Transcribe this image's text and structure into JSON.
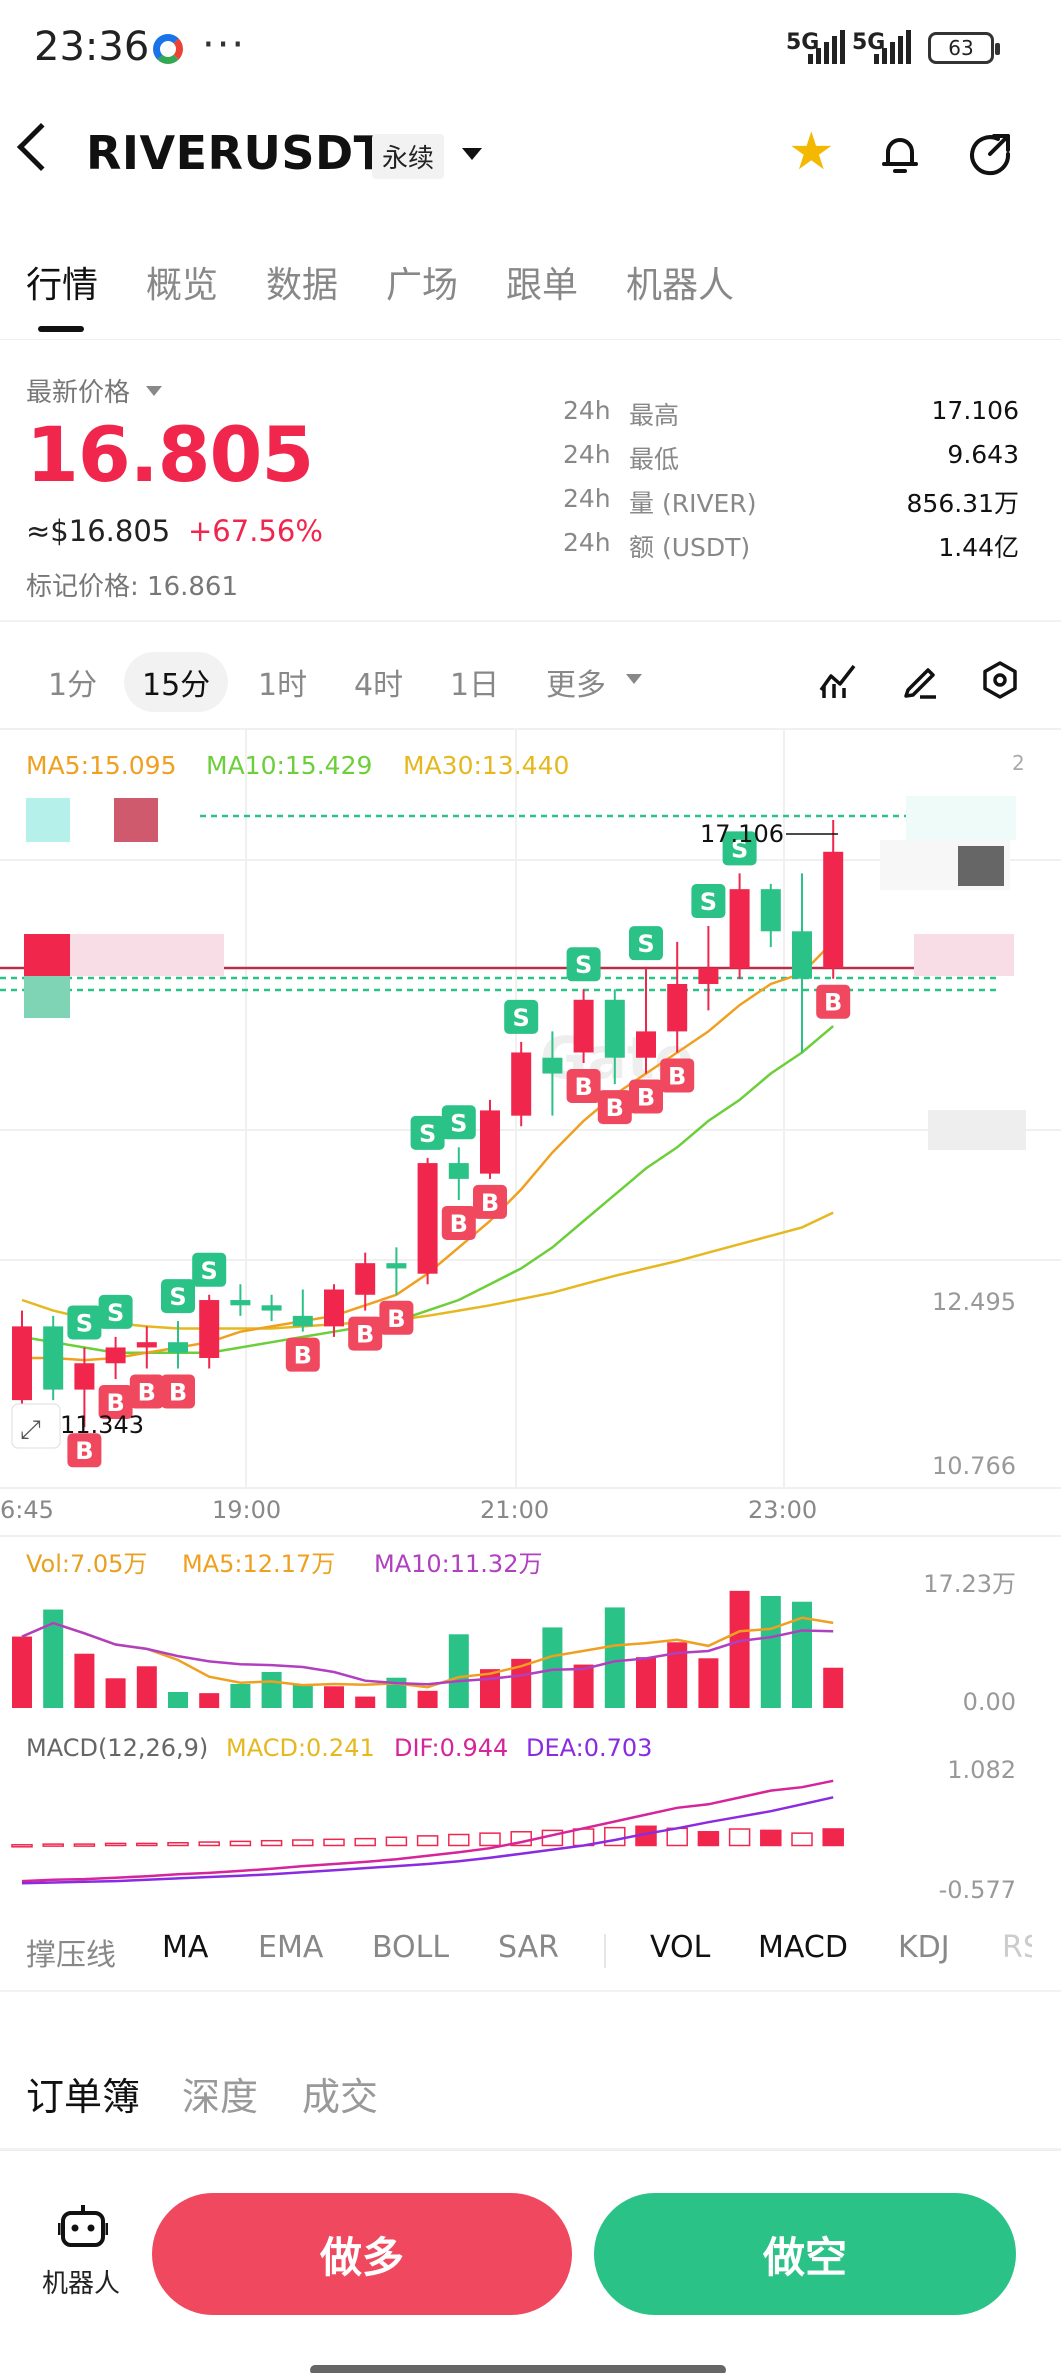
{
  "status_bar": {
    "time": "23:36",
    "more": "···",
    "signal1": "5G",
    "signal2": "5G",
    "battery": "63"
  },
  "header": {
    "symbol": "RIVERUSDT",
    "contract_type": "永续"
  },
  "tabs": [
    "行情",
    "概览",
    "数据",
    "广场",
    "跟单",
    "机器人"
  ],
  "price": {
    "label": "最新价格",
    "last": "16.805",
    "approx_usd": "≈$16.805",
    "change": "+67.56%",
    "mark_label": "标记价格:",
    "mark_value": "16.861"
  },
  "stats": [
    {
      "period": "24h",
      "name": "最高",
      "value": "17.106"
    },
    {
      "period": "24h",
      "name": "最低",
      "value": "9.643"
    },
    {
      "period": "24h",
      "name": "量 (RIVER)",
      "value": "856.31万"
    },
    {
      "period": "24h",
      "name": "额 (USDT)",
      "value": "1.44亿"
    }
  ],
  "intervals": {
    "items": [
      "1分",
      "15分",
      "1时",
      "4时",
      "1日"
    ],
    "active": "15分",
    "more": "更多"
  },
  "chart_data": [
    {
      "type": "candlestick",
      "legend": {
        "ma5": "MA5:15.095",
        "ma10": "MA10:15.429",
        "ma30": "MA30:13.440"
      },
      "y_ticks": [
        "12.495",
        "10.766"
      ],
      "x_ticks": [
        "6:45",
        "19:00",
        "21:00",
        "23:00"
      ],
      "high_label": "17.106",
      "low_label": "11.343",
      "watermark": "Gate",
      "colors": {
        "up": "#f0264d",
        "down": "#2bc287",
        "ma5": "#f0a020",
        "ma10": "#6ccf3a",
        "ma30": "#e6b820"
      },
      "candles": [
        {
          "o": 11.6,
          "c": 12.3,
          "h": 12.45,
          "l": 11.5
        },
        {
          "o": 12.3,
          "c": 11.7,
          "h": 12.4,
          "l": 11.6
        },
        {
          "o": 11.7,
          "c": 11.95,
          "h": 12.1,
          "l": 11.343
        },
        {
          "o": 11.95,
          "c": 12.1,
          "h": 12.2,
          "l": 11.8
        },
        {
          "o": 12.1,
          "c": 12.15,
          "h": 12.3,
          "l": 11.9
        },
        {
          "o": 12.15,
          "c": 12.05,
          "h": 12.35,
          "l": 11.9
        },
        {
          "o": 12.0,
          "c": 12.55,
          "h": 12.6,
          "l": 11.9
        },
        {
          "o": 12.55,
          "c": 12.5,
          "h": 12.7,
          "l": 12.4
        },
        {
          "o": 12.5,
          "c": 12.45,
          "h": 12.6,
          "l": 12.35
        },
        {
          "o": 12.4,
          "c": 12.3,
          "h": 12.65,
          "l": 12.25
        },
        {
          "o": 12.3,
          "c": 12.65,
          "h": 12.7,
          "l": 12.2
        },
        {
          "o": 12.6,
          "c": 12.9,
          "h": 13.0,
          "l": 12.45
        },
        {
          "o": 12.9,
          "c": 12.85,
          "h": 13.05,
          "l": 12.6
        },
        {
          "o": 12.8,
          "c": 13.85,
          "h": 13.9,
          "l": 12.7
        },
        {
          "o": 13.85,
          "c": 13.7,
          "h": 14.0,
          "l": 13.5
        },
        {
          "o": 13.75,
          "c": 14.35,
          "h": 14.45,
          "l": 13.7
        },
        {
          "o": 14.3,
          "c": 14.9,
          "h": 15.0,
          "l": 14.2
        },
        {
          "o": 14.85,
          "c": 14.7,
          "h": 15.1,
          "l": 14.3
        },
        {
          "o": 14.9,
          "c": 15.4,
          "h": 15.5,
          "l": 14.8
        },
        {
          "o": 15.4,
          "c": 14.85,
          "h": 15.5,
          "l": 14.6
        },
        {
          "o": 14.85,
          "c": 15.1,
          "h": 15.7,
          "l": 14.7
        },
        {
          "o": 15.1,
          "c": 15.55,
          "h": 15.95,
          "l": 14.9
        },
        {
          "o": 15.55,
          "c": 15.7,
          "h": 16.1,
          "l": 15.3
        },
        {
          "o": 15.7,
          "c": 16.45,
          "h": 16.6,
          "l": 15.6
        },
        {
          "o": 16.45,
          "c": 16.05,
          "h": 16.5,
          "l": 15.9
        },
        {
          "o": 16.05,
          "c": 15.6,
          "h": 16.6,
          "l": 14.9
        },
        {
          "o": 15.7,
          "c": 16.805,
          "h": 17.106,
          "l": 15.6
        }
      ],
      "ma5": [
        12.0,
        12.0,
        11.98,
        12.0,
        12.05,
        12.1,
        12.15,
        12.25,
        12.3,
        12.35,
        12.4,
        12.5,
        12.6,
        12.8,
        13.05,
        13.3,
        13.6,
        13.95,
        14.25,
        14.5,
        14.7,
        14.9,
        15.1,
        15.35,
        15.55,
        15.65,
        15.95
      ],
      "ma10": [
        12.2,
        12.15,
        12.1,
        12.05,
        12.05,
        12.05,
        12.05,
        12.1,
        12.15,
        12.2,
        12.25,
        12.3,
        12.35,
        12.45,
        12.55,
        12.7,
        12.85,
        13.05,
        13.3,
        13.55,
        13.8,
        14.0,
        14.25,
        14.45,
        14.7,
        14.9,
        15.15
      ],
      "ma30": [
        12.55,
        12.45,
        12.38,
        12.33,
        12.3,
        12.28,
        12.28,
        12.28,
        12.28,
        12.3,
        12.32,
        12.34,
        12.36,
        12.4,
        12.45,
        12.5,
        12.56,
        12.62,
        12.7,
        12.78,
        12.85,
        12.92,
        13.0,
        13.08,
        13.16,
        13.24,
        13.38
      ],
      "ylim": [
        10.766,
        17.6
      ]
    },
    {
      "type": "bar",
      "legend": {
        "vol": "Vol:7.05万",
        "ma5": "MA5:12.17万",
        "ma10": "MA10:11.32万"
      },
      "y_ticks": [
        "17.23万",
        "0.00"
      ],
      "values": [
        12.5,
        17.23,
        9.5,
        5.2,
        7.3,
        2.8,
        2.6,
        4.2,
        6.3,
        4.1,
        3.8,
        2.0,
        5.3,
        3.0,
        12.9,
        6.8,
        8.6,
        14.1,
        7.6,
        17.6,
        8.9,
        11.5,
        8.7,
        20.5,
        19.6,
        18.6,
        7.05
      ],
      "ylim": [
        0,
        21.0
      ]
    },
    {
      "type": "bar",
      "legend": {
        "title": "MACD(12,26,9)",
        "macd": "MACD:0.241",
        "dif": "DIF:0.944",
        "dea": "DEA:0.703"
      },
      "y_ticks": [
        "1.082",
        "-0.577"
      ],
      "hist": [
        0.01,
        0.02,
        0.02,
        0.03,
        0.03,
        0.04,
        0.05,
        0.06,
        0.07,
        0.08,
        0.09,
        0.1,
        0.12,
        0.14,
        0.16,
        0.18,
        0.2,
        0.22,
        0.24,
        0.26,
        0.28,
        0.25,
        0.2,
        0.24,
        0.22,
        0.18,
        0.241
      ],
      "dif": [
        -0.52,
        -0.5,
        -0.49,
        -0.47,
        -0.45,
        -0.42,
        -0.4,
        -0.37,
        -0.34,
        -0.3,
        -0.27,
        -0.24,
        -0.2,
        -0.15,
        -0.1,
        -0.04,
        0.05,
        0.15,
        0.25,
        0.35,
        0.45,
        0.55,
        0.6,
        0.7,
        0.8,
        0.85,
        0.944
      ],
      "dea": [
        -0.55,
        -0.54,
        -0.53,
        -0.52,
        -0.5,
        -0.48,
        -0.46,
        -0.44,
        -0.42,
        -0.39,
        -0.36,
        -0.33,
        -0.3,
        -0.27,
        -0.23,
        -0.18,
        -0.12,
        -0.06,
        0.0,
        0.08,
        0.17,
        0.25,
        0.34,
        0.42,
        0.5,
        0.6,
        0.703
      ],
      "ylim": [
        -0.62,
        1.13
      ]
    }
  ],
  "indicator_tabs": [
    "撑压线",
    "MA",
    "EMA",
    "BOLL",
    "SAR",
    "VOL",
    "MACD",
    "KDJ",
    "RSI"
  ],
  "indicator_active": [
    "MA",
    "VOL",
    "MACD"
  ],
  "orderbook_tabs": [
    "订单簿",
    "深度",
    "成交"
  ],
  "bottom": {
    "robot_label": "机器人",
    "long_label": "做多",
    "short_label": "做空"
  }
}
